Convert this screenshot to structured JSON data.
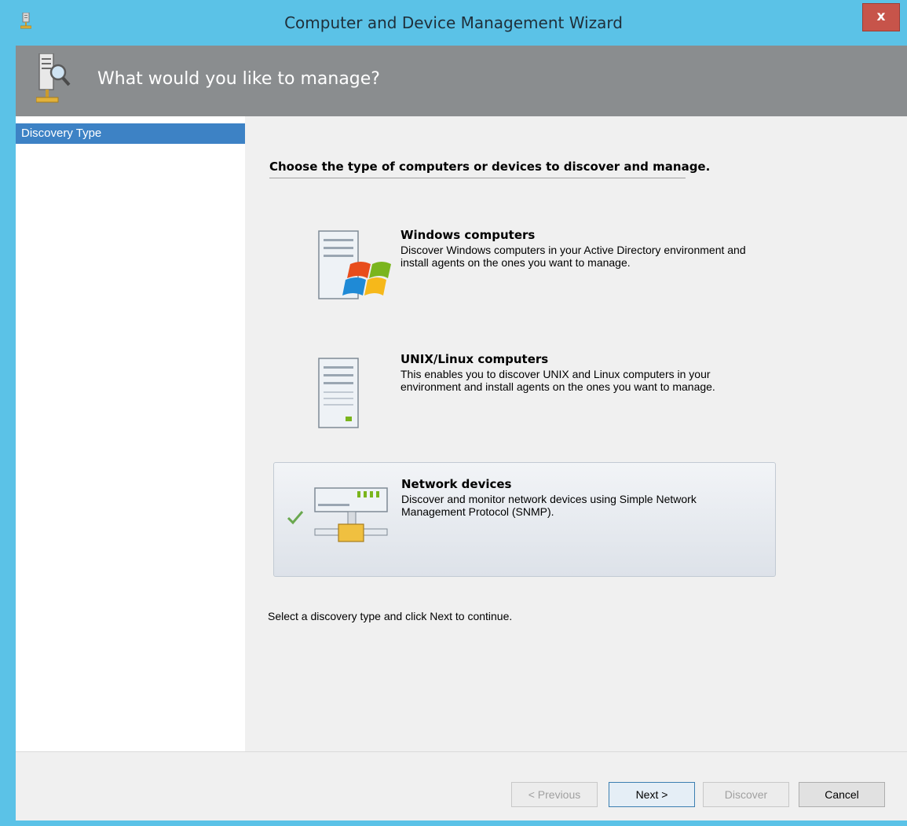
{
  "window": {
    "title": "Computer and Device Management Wizard",
    "close_label": "x"
  },
  "header": {
    "title": "What would you like to manage?"
  },
  "sidebar": {
    "items": [
      {
        "label": "Discovery Type",
        "selected": true
      }
    ]
  },
  "main": {
    "heading": "Choose the type of computers or devices to discover and manage.",
    "options": [
      {
        "title": "Windows computers",
        "description": "Discover Windows computers in your Active Directory environment and install agents on the ones you want to manage.",
        "icon": "windows-server-icon",
        "selected": false
      },
      {
        "title": "UNIX/Linux computers",
        "description": "This enables you to discover UNIX and Linux computers in your environment and install agents on the ones you want to manage.",
        "icon": "server-icon",
        "selected": false
      },
      {
        "title": "Network devices",
        "description": "Discover and monitor network devices using Simple Network Management Protocol (SNMP).",
        "icon": "network-device-icon",
        "selected": true
      }
    ],
    "hint": "Select a discovery type and click Next to continue."
  },
  "footer": {
    "previous_label": "< Previous",
    "next_label": "Next >",
    "discover_label": "Discover",
    "cancel_label": "Cancel"
  },
  "colors": {
    "titlebar": "#5bc2e7",
    "header_band": "#8a8d8f",
    "sidebar_selected": "#3d82c5",
    "close_button": "#c7544a"
  }
}
